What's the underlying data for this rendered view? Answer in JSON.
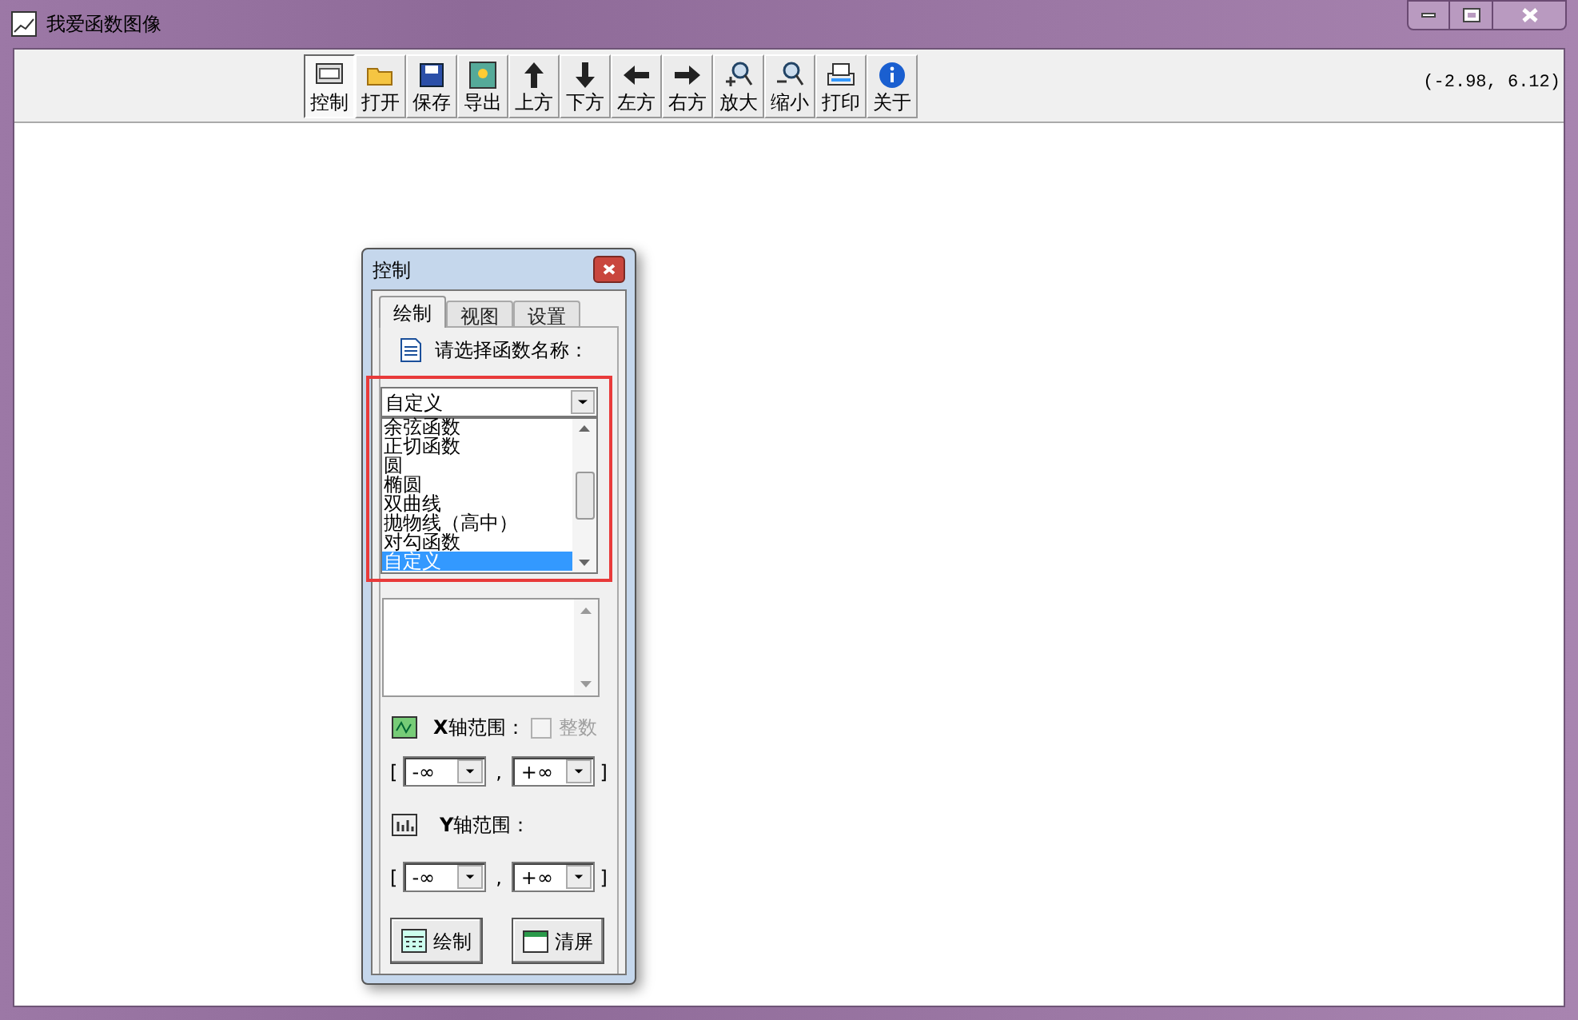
{
  "window": {
    "title": "我爱函数图像"
  },
  "toolbar": [
    {
      "label": "控制",
      "kind": "control",
      "selected": true
    },
    {
      "label": "打开",
      "kind": "open",
      "selected": false
    },
    {
      "label": "保存",
      "kind": "save",
      "selected": false
    },
    {
      "label": "导出",
      "kind": "export",
      "selected": false
    },
    {
      "label": "上方",
      "kind": "up",
      "selected": false
    },
    {
      "label": "下方",
      "kind": "down",
      "selected": false
    },
    {
      "label": "左方",
      "kind": "left",
      "selected": false
    },
    {
      "label": "右方",
      "kind": "right",
      "selected": false
    },
    {
      "label": "放大",
      "kind": "zoom-in",
      "selected": false
    },
    {
      "label": "缩小",
      "kind": "zoom-out",
      "selected": false
    },
    {
      "label": "打印",
      "kind": "print",
      "selected": false
    },
    {
      "label": "关于",
      "kind": "about",
      "selected": false
    }
  ],
  "coordinates": "(-2.98, 6.12)",
  "control_panel": {
    "title": "控制",
    "tabs": [
      {
        "label": "绘制",
        "selected": true
      },
      {
        "label": "视图",
        "selected": false
      },
      {
        "label": "设置",
        "selected": false
      }
    ],
    "function_prompt": "请选择函数名称：",
    "function_select": {
      "value": "自定义",
      "options": [
        {
          "label": "余弦函数",
          "selected": false
        },
        {
          "label": "正切函数",
          "selected": false
        },
        {
          "label": "圆",
          "selected": false
        },
        {
          "label": "椭圆",
          "selected": false
        },
        {
          "label": "双曲线",
          "selected": false
        },
        {
          "label": "抛物线（高中）",
          "selected": false
        },
        {
          "label": "对勾函数",
          "selected": false
        },
        {
          "label": "自定义",
          "selected": true
        }
      ]
    },
    "x_axis": {
      "label": "**X**轴范围：",
      "integer_checkbox": {
        "label": "整数",
        "checked": false,
        "disabled": true
      },
      "open_bracket": "[",
      "min": "-∞",
      "separator": ",",
      "max": "+∞",
      "close_bracket": "]"
    },
    "y_axis": {
      "label": "**Y**轴范围：",
      "open_bracket": "[",
      "min": "-∞",
      "separator": ",",
      "max": "+∞",
      "close_bracket": "]"
    },
    "buttons": [
      {
        "label": "绘制",
        "kind": "draw"
      },
      {
        "label": "清屏",
        "kind": "clear"
      }
    ]
  }
}
